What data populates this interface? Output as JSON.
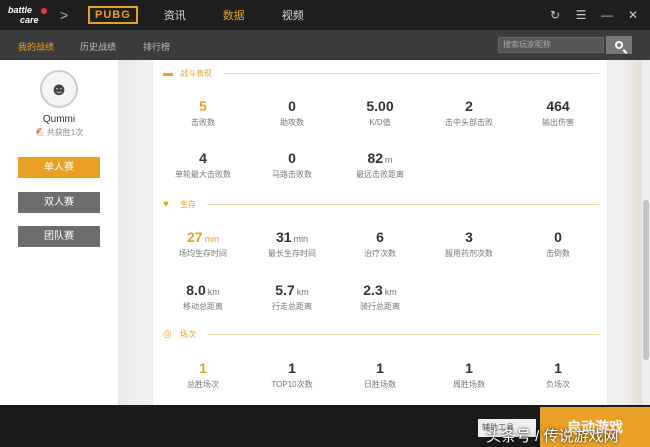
{
  "topbar": {
    "logo_line1": "battle",
    "logo_line2": "care",
    "chevron": ">",
    "game_logo": "PUBG",
    "nav": [
      {
        "label": "资讯",
        "active": false
      },
      {
        "label": "数据",
        "active": true
      },
      {
        "label": "视频",
        "active": false
      }
    ],
    "controls": [
      {
        "name": "refresh-icon",
        "glyph": "↻"
      },
      {
        "name": "menu-icon",
        "glyph": "☰"
      },
      {
        "name": "minimize-icon",
        "glyph": "—"
      },
      {
        "name": "close-icon",
        "glyph": "✕"
      }
    ]
  },
  "subnav": {
    "tabs": [
      {
        "label": "我的战绩",
        "active": true
      },
      {
        "label": "历史战绩",
        "active": false
      },
      {
        "label": "排行榜",
        "active": false
      }
    ],
    "search_placeholder": "搜索玩家昵称"
  },
  "profile": {
    "username": "Qummi",
    "total_wins": "共获胜1次",
    "modes": [
      {
        "label": "单人赛",
        "active": true
      },
      {
        "label": "双人赛",
        "active": false
      },
      {
        "label": "团队赛",
        "active": false
      }
    ]
  },
  "sections": {
    "combat": {
      "title": "战斗表现",
      "icon": "gun-icon",
      "stats": [
        {
          "value": "5",
          "unit": "",
          "label": "击败数",
          "highlight": true
        },
        {
          "value": "0",
          "unit": "",
          "label": "助攻数",
          "highlight": false
        },
        {
          "value": "5.00",
          "unit": "",
          "label": "K/D值",
          "highlight": false
        },
        {
          "value": "2",
          "unit": "",
          "label": "击中头部击败",
          "highlight": false
        },
        {
          "value": "464",
          "unit": "",
          "label": "输出伤害",
          "highlight": false
        },
        {
          "value": "4",
          "unit": "",
          "label": "单轮最大击败数",
          "highlight": false
        },
        {
          "value": "0",
          "unit": "",
          "label": "马路击败数",
          "highlight": false
        },
        {
          "value": "82",
          "unit": "m",
          "label": "最远击败距离",
          "highlight": false
        }
      ]
    },
    "survival": {
      "title": "生存",
      "icon": "heartbeat-icon",
      "stats": [
        {
          "value": "27",
          "unit": "min",
          "label": "场均生存时间",
          "highlight": true
        },
        {
          "value": "31",
          "unit": "min",
          "label": "最长生存时间",
          "highlight": false
        },
        {
          "value": "6",
          "unit": "",
          "label": "治疗次数",
          "highlight": false
        },
        {
          "value": "3",
          "unit": "",
          "label": "服用药剂次数",
          "highlight": false
        },
        {
          "value": "0",
          "unit": "",
          "label": "击倒数",
          "highlight": false
        },
        {
          "value": "8.0",
          "unit": "km",
          "label": "移动总距离",
          "highlight": false
        },
        {
          "value": "5.7",
          "unit": "km",
          "label": "行走总距离",
          "highlight": false
        },
        {
          "value": "2.3",
          "unit": "km",
          "label": "骑行总距离",
          "highlight": false
        }
      ]
    },
    "matches": {
      "title": "场次",
      "icon": "target-icon",
      "stats": [
        {
          "value": "1",
          "unit": "",
          "label": "总胜场次",
          "highlight": true
        },
        {
          "value": "1",
          "unit": "",
          "label": "TOP10次数",
          "highlight": false
        },
        {
          "value": "1",
          "unit": "",
          "label": "日胜场数",
          "highlight": false
        },
        {
          "value": "1",
          "unit": "",
          "label": "周胜场数",
          "highlight": false
        },
        {
          "value": "1",
          "unit": "",
          "label": "负场次",
          "highlight": false
        }
      ]
    }
  },
  "bottom": {
    "box_label": "辅助工具",
    "launch_label": "启动游戏",
    "watermark": "头条号 / 传说游戏网"
  },
  "colors": {
    "accent": "#e8a125",
    "topbar": "#1e1e1e",
    "subbar": "#3b3b3b"
  }
}
